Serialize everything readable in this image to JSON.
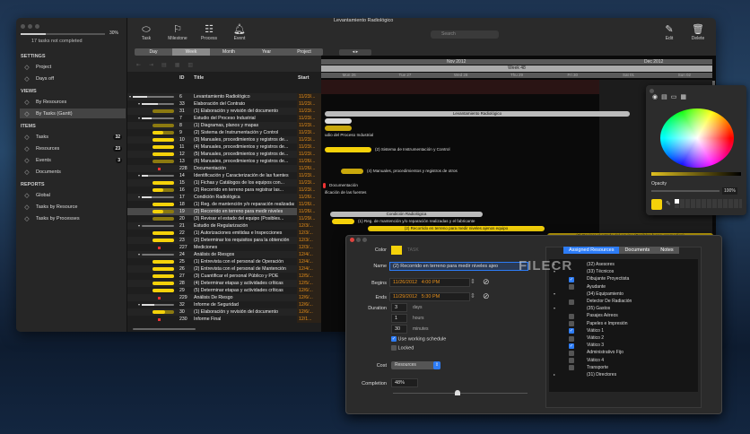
{
  "window": {
    "title": "Levantamiento Radiológico"
  },
  "sidebar": {
    "progress_percent": 30,
    "progress_label": "30%",
    "status": "17 tasks not completed",
    "sections": [
      {
        "title": "SETTINGS",
        "items": [
          {
            "label": "Project",
            "icon": "project-icon"
          },
          {
            "label": "Days off",
            "icon": "calendar-icon"
          }
        ]
      },
      {
        "title": "VIEWS",
        "items": [
          {
            "label": "By Resources",
            "icon": "org-chart-icon"
          },
          {
            "label": "By Tasks (Gantt)",
            "icon": "gantt-icon",
            "selected": true
          }
        ]
      },
      {
        "title": "ITEMS",
        "items": [
          {
            "label": "Tasks",
            "icon": "task-icon",
            "badge": "32"
          },
          {
            "label": "Resources",
            "icon": "resources-icon",
            "badge": "23"
          },
          {
            "label": "Events",
            "icon": "bell-icon",
            "badge": "3"
          },
          {
            "label": "Documents",
            "icon": "paperclip-icon"
          }
        ]
      },
      {
        "title": "REPORTS",
        "items": [
          {
            "label": "Global",
            "icon": "report-icon"
          },
          {
            "label": "Tasks by Resource",
            "icon": "report-icon"
          },
          {
            "label": "Tasks by Processes",
            "icon": "report-icon"
          }
        ]
      }
    ]
  },
  "toolbar": {
    "task": "Task",
    "milestone": "Milestone",
    "process": "Process",
    "event": "Event",
    "search_placeholder": "Search",
    "edit": "Edit",
    "delete": "Delete"
  },
  "scale": {
    "options": [
      "Day",
      "Week",
      "Month",
      "Year",
      "Project"
    ],
    "selected": "Week"
  },
  "table": {
    "headers": {
      "id": "ID",
      "title": "Title",
      "start": "Start"
    },
    "rows": [
      {
        "id": "6",
        "title": "Levantamiento Radiológico",
        "start": "11/23/...",
        "type": "group",
        "level": 0,
        "progress": 0.35
      },
      {
        "id": "33",
        "title": "Elaboración del Contrato",
        "start": "11/23/...",
        "type": "group",
        "level": 1,
        "progress": 0.5
      },
      {
        "id": "31",
        "title": "(1) Elaboración y revisión del documento",
        "start": "11/23/...",
        "type": "task",
        "progress": 0.0
      },
      {
        "id": "7",
        "title": "Estudio del Proceso Industrial",
        "start": "11/23/...",
        "type": "group",
        "level": 1,
        "progress": 0.3
      },
      {
        "id": "8",
        "title": "(1) Diagramas, planos y mapas",
        "start": "11/23/...",
        "type": "task",
        "progress": 0.0
      },
      {
        "id": "9",
        "title": "(2) Sistema de Instrumentación y Control",
        "start": "11/23/...",
        "type": "task",
        "progress": 0.5
      },
      {
        "id": "10",
        "title": "(3) Manuales, procedimientos y registros de...",
        "start": "11/23/...",
        "type": "task",
        "progress": 1
      },
      {
        "id": "11",
        "title": "(4) Manuales, procedimientos y registros de...",
        "start": "11/23/...",
        "type": "task",
        "progress": 1
      },
      {
        "id": "12",
        "title": "(5) Manuales, procedimientos y registros de...",
        "start": "11/23/...",
        "type": "task",
        "progress": 1
      },
      {
        "id": "13",
        "title": "(6) Manuales, procedimientos y registros de...",
        "start": "11/26/...",
        "type": "task",
        "progress": 0.0
      },
      {
        "id": "228",
        "title": "Documentación",
        "start": "11/26/...",
        "type": "milestone"
      },
      {
        "id": "14",
        "title": "Identificación y Caracterización de las fuentes",
        "start": "11/23/...",
        "type": "group",
        "level": 1,
        "progress": 0.2
      },
      {
        "id": "15",
        "title": "(1) Fichas y Catálogos de los equipos con...",
        "start": "11/23/...",
        "type": "task",
        "progress": 1
      },
      {
        "id": "16",
        "title": "(2) Recorrido en terreno para registrar las...",
        "start": "11/23/...",
        "type": "task",
        "progress": 0.5
      },
      {
        "id": "17",
        "title": "Condición Radiológica",
        "start": "11/26/...",
        "type": "group",
        "level": 1,
        "progress": 0.3
      },
      {
        "id": "18",
        "title": "(1) Reg. de mantención y/o reparación realizadas",
        "start": "11/26/...",
        "type": "task",
        "progress": 1
      },
      {
        "id": "19",
        "title": "(2) Recorrido en terreno para medir niveles",
        "start": "11/26/...",
        "type": "task",
        "progress": 0.48,
        "selected": true
      },
      {
        "id": "20",
        "title": "(3) Revisar el estado del equipo (Posibles...",
        "start": "11/29/...",
        "type": "task",
        "progress": 0.0
      },
      {
        "id": "21",
        "title": "Estudio de Regularización",
        "start": "12/3/...",
        "type": "group",
        "level": 1,
        "progress": 0.0
      },
      {
        "id": "22",
        "title": "(1) Autorizaciones emitidas e Inspecciones",
        "start": "12/3/...",
        "type": "task",
        "progress": 1
      },
      {
        "id": "23",
        "title": "(2) Determinar los requisitos para la obtención",
        "start": "12/3/...",
        "type": "task",
        "progress": 1
      },
      {
        "id": "227",
        "title": "Mediciones",
        "start": "12/3/...",
        "type": "milestone"
      },
      {
        "id": "24",
        "title": "Análisis de Riesgos",
        "start": "12/4/...",
        "type": "group",
        "level": 1,
        "progress": 0.0
      },
      {
        "id": "25",
        "title": "(1) Entrevista con el personal de Operación",
        "start": "12/4/...",
        "type": "task",
        "progress": 1
      },
      {
        "id": "26",
        "title": "(2) Entrevista con el personal de Mantención",
        "start": "12/4/...",
        "type": "task",
        "progress": 1
      },
      {
        "id": "27",
        "title": "(3) Cuantificar el personal Público y POE",
        "start": "12/5/...",
        "type": "task",
        "progress": 1
      },
      {
        "id": "28",
        "title": "(4) Determinar etapas y actividades críticas",
        "start": "12/5/...",
        "type": "task",
        "progress": 1
      },
      {
        "id": "29",
        "title": "(5) Determinar etapas y actividades críticas",
        "start": "12/6/...",
        "type": "task",
        "progress": 1
      },
      {
        "id": "229",
        "title": "Análisis De Riesgo",
        "start": "12/6/...",
        "type": "milestone"
      },
      {
        "id": "32",
        "title": "Informe de Seguridad",
        "start": "12/6/...",
        "type": "group",
        "level": 1,
        "progress": 0.4
      },
      {
        "id": "30",
        "title": "(1) Elaboración y revisión del documento",
        "start": "12/6/...",
        "type": "task",
        "progress": 0.6
      },
      {
        "id": "230",
        "title": "Informe Final",
        "start": "12/1...",
        "type": "milestone"
      }
    ]
  },
  "gantt": {
    "months": [
      "Nov 2012",
      "Dec 2012"
    ],
    "week": "Week 48",
    "days": [
      "Mon 26",
      "Tue 27",
      "Wed 28",
      "Thu 29",
      "Fri 30",
      "Sat 01",
      "Sun 02"
    ],
    "labels": {
      "g0": "Levantamiento Radiológico",
      "g3": "udio del Proceso Industrial",
      "g5": "(2) Sistema de Instrumentación y Control",
      "g8": "(4) Manuales, procedimientos y registros de otros",
      "g10": "Documentación",
      "g11": "ificación de las fuentes",
      "g14": "Condición Radiológica",
      "g15": "(1) Reg. de mantención y/o reparación realizadas y el fabricante",
      "g16": "(2) Recorrido en terreno para medir niveles ajenos equipo",
      "g17": "(3) Revisar el estado del equipo (Posibles fugas, promedios)"
    }
  },
  "color_panel": {
    "opacity_label": "Opacity",
    "opacity_value": "100%",
    "selected_color": "#f5d20a"
  },
  "task_editor": {
    "color_label": "Color",
    "color_value": "#f5d20a",
    "type_text": "TASK",
    "name_label": "Name",
    "name_value": "(2) Recorrido en terreno para medir niveles ajeo",
    "begins_label": "Begins",
    "begins_date": "11/26/2012",
    "begins_time": "4:00 PM",
    "ends_label": "Ends",
    "ends_date": "11/29/2012",
    "ends_time": "5:30 PM",
    "duration_label": "Duration",
    "days": "3",
    "days_unit": "days",
    "hours": "1",
    "hours_unit": "hours",
    "minutes": "30",
    "minutes_unit": "minutes",
    "use_working_schedule": "Use working schedule",
    "use_working_schedule_checked": true,
    "locked": "Locked",
    "locked_checked": false,
    "cost_label": "Cost",
    "cost_value": "Resources",
    "completion_label": "Completion",
    "completion_value": "48%",
    "completion_percent": 48,
    "tabs": [
      "Assigned Resources",
      "Documents",
      "Notes"
    ],
    "active_tab": "Assigned Resources",
    "resources": [
      {
        "label": "(32) Asesores",
        "type": "group",
        "expanded": false
      },
      {
        "label": "(33) Técnicos",
        "type": "group",
        "expanded": true
      },
      {
        "label": "Dibujante Proyectista",
        "checked": true
      },
      {
        "label": "Ayudante",
        "checked": false
      },
      {
        "label": "(34) Equipamiento",
        "type": "group",
        "expanded": true
      },
      {
        "label": "Detector De Radiación",
        "checked": false
      },
      {
        "label": "(35) Gastos",
        "type": "group",
        "expanded": true
      },
      {
        "label": "Pasajes Aéreos",
        "checked": false
      },
      {
        "label": "Papeles e Impresión",
        "checked": false
      },
      {
        "label": "Viático 1",
        "checked": true
      },
      {
        "label": "Viático 2",
        "checked": false
      },
      {
        "label": "Viático 3",
        "checked": true
      },
      {
        "label": "Administrativo Fijo",
        "checked": false
      },
      {
        "label": "Viático 4",
        "checked": false
      },
      {
        "label": "Transporte",
        "checked": false
      },
      {
        "label": "(31) Directores",
        "type": "group",
        "expanded": false
      }
    ]
  },
  "watermark": "FILECR .com"
}
